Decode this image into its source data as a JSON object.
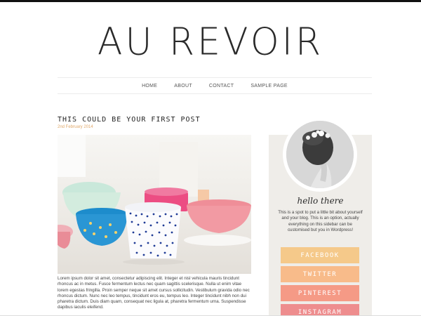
{
  "site": {
    "title": "AU REVOIR"
  },
  "nav": {
    "items": [
      "HOME",
      "ABOUT",
      "CONTACT",
      "SAMPLE PAGE"
    ]
  },
  "post": {
    "title": "THIS COULD BE YOUR FIRST POST",
    "date": "2nd February 2014",
    "body": "Lorem ipsum dolor sit amet, consectetur adipiscing elit. Integer et nisl vehicula mauris tincidunt rhoncus ac in metus. Fusce fermentum lectus nec quam sagittis scelerisque. Nulla ut enim vitae lorem egestas fringilla. Proin semper neque sit amet cursus sollicitudin. Vestibulum gravida odio nec rhoncus dictum. Nunc nec leo tempus, tincidunt eros eu, tempus leo. Integer tincidunt nibh non dui pharetra dictum. Duis diam quam, consequat nec ligula at, pharetra fermentum urna. Suspendisse dapibus iaculis eleifend."
  },
  "sidebar": {
    "greeting": "hello there",
    "bio": "This is a spot to put a little bit about yourself and your blog. This is an option, actually everything on this sidebar can be customised but you in Wordpress!",
    "social": [
      {
        "label": "FACEBOOK",
        "color": "#f5c98a"
      },
      {
        "label": "TWITTER",
        "color": "#f8bb8a"
      },
      {
        "label": "PINTEREST",
        "color": "#f59a86"
      },
      {
        "label": "INSTAGRAM",
        "color": "#ee8d8e"
      }
    ]
  },
  "colors": {
    "accent": "#e0a86a",
    "sidebar_bg": "#efede9"
  }
}
